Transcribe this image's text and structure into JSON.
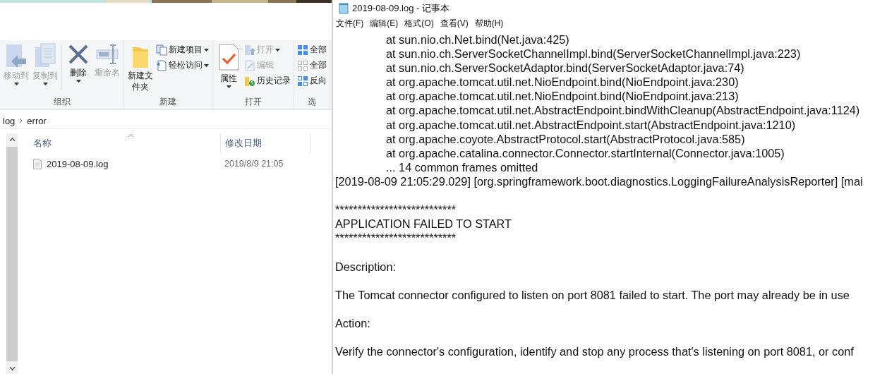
{
  "explorer": {
    "ribbon_groups": [
      {
        "label": "组织",
        "items": [
          {
            "label": "移动到",
            "kind": "large",
            "disabled": true,
            "dropdown": true
          },
          {
            "label": "复制到",
            "kind": "large",
            "disabled": true,
            "dropdown": true
          },
          {
            "label": "删除",
            "kind": "large",
            "disabled": false,
            "dropdown": true
          },
          {
            "label": "重命名",
            "kind": "large",
            "disabled": true,
            "dropdown": false
          }
        ]
      },
      {
        "label": "新建",
        "items": [
          {
            "label": "新建文件夹",
            "kind": "large",
            "disabled": false,
            "dropdown": false
          },
          {
            "label": "新建项目",
            "kind": "small",
            "disabled": false,
            "dropdown": true
          },
          {
            "label": "轻松访问",
            "kind": "small",
            "disabled": false,
            "dropdown": true
          }
        ]
      },
      {
        "label": "打开",
        "items": [
          {
            "label": "属性",
            "kind": "large",
            "disabled": false,
            "dropdown": true
          },
          {
            "label": "打开",
            "kind": "small",
            "disabled": true,
            "dropdown": true
          },
          {
            "label": "编辑",
            "kind": "small",
            "disabled": true,
            "dropdown": false
          },
          {
            "label": "历史记录",
            "kind": "small",
            "disabled": false,
            "dropdown": false
          }
        ]
      },
      {
        "label": "选",
        "items": [
          {
            "label": "全部",
            "kind": "small",
            "disabled": false,
            "dropdown": false
          },
          {
            "label": "全部",
            "kind": "small",
            "disabled": false,
            "dropdown": false
          },
          {
            "label": "反向",
            "kind": "small",
            "disabled": false,
            "dropdown": false
          }
        ]
      }
    ],
    "breadcrumb": [
      "log",
      "error"
    ],
    "columns": [
      "名称",
      "修改日期"
    ],
    "files": [
      {
        "name": "2019-08-09.log",
        "modified": "2019/8/9 21:05"
      }
    ]
  },
  "notepad": {
    "title": "2019-08-09.log - 记事本",
    "menu": [
      "文件(F)",
      "编辑(E)",
      "格式(O)",
      "查看(V)",
      "帮助(H)"
    ],
    "lines": [
      {
        "kind": "stack",
        "text": "at sun.nio.ch.Net.bind(Net.java:425)"
      },
      {
        "kind": "stack",
        "text": "at sun.nio.ch.ServerSocketChannelImpl.bind(ServerSocketChannelImpl.java:223)"
      },
      {
        "kind": "stack",
        "text": "at sun.nio.ch.ServerSocketAdaptor.bind(ServerSocketAdaptor.java:74)"
      },
      {
        "kind": "stack",
        "text": "at org.apache.tomcat.util.net.NioEndpoint.bind(NioEndpoint.java:230)"
      },
      {
        "kind": "stack",
        "text": "at org.apache.tomcat.util.net.NioEndpoint.bind(NioEndpoint.java:213)"
      },
      {
        "kind": "stack",
        "text": "at org.apache.tomcat.util.net.AbstractEndpoint.bindWithCleanup(AbstractEndpoint.java:1124)"
      },
      {
        "kind": "stack",
        "text": "at org.apache.tomcat.util.net.AbstractEndpoint.start(AbstractEndpoint.java:1210)"
      },
      {
        "kind": "stack",
        "text": "at org.apache.coyote.AbstractProtocol.start(AbstractProtocol.java:585)"
      },
      {
        "kind": "stack",
        "text": "at org.apache.catalina.connector.Connector.startInternal(Connector.java:1005)"
      },
      {
        "kind": "stack",
        "text": "... 14 common frames omitted"
      },
      {
        "kind": "text",
        "text": "[2019-08-09 21:05:29.029] [org.springframework.boot.diagnostics.LoggingFailureAnalysisReporter] [mai"
      },
      {
        "kind": "blank"
      },
      {
        "kind": "text",
        "text": "***************************"
      },
      {
        "kind": "text",
        "text": "APPLICATION FAILED TO START"
      },
      {
        "kind": "text",
        "text": "***************************"
      },
      {
        "kind": "blank"
      },
      {
        "kind": "text",
        "text": "Description:"
      },
      {
        "kind": "blank"
      },
      {
        "kind": "text",
        "text": "The Tomcat connector configured to listen on port 8081 failed to start. The port may already be in use"
      },
      {
        "kind": "blank"
      },
      {
        "kind": "text",
        "text": "Action:"
      },
      {
        "kind": "blank"
      },
      {
        "kind": "text",
        "text": "Verify the connector's configuration, identify and stop any process that's listening on port 8081, or conf"
      }
    ]
  }
}
